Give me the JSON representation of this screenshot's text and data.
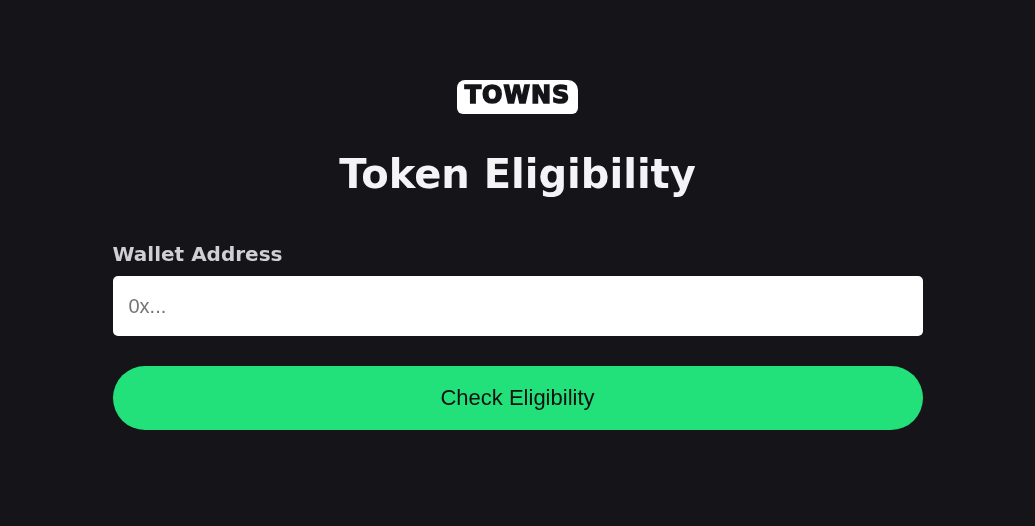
{
  "logo": "TOWNS",
  "title": "Token Eligibility",
  "wallet_field": {
    "label": "Wallet Address",
    "placeholder": "0x..."
  },
  "submit_button": "Check Eligibility"
}
